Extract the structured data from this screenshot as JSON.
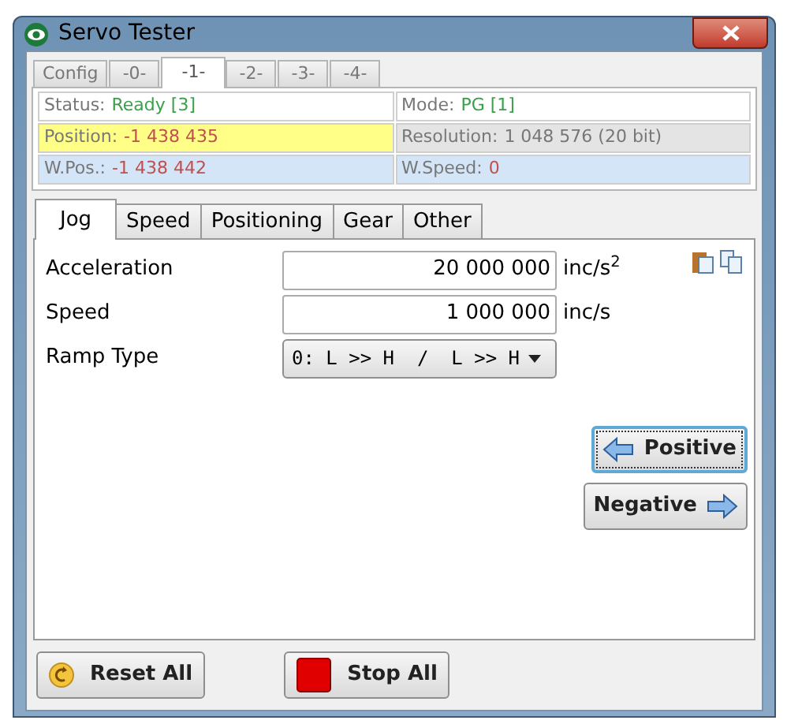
{
  "window": {
    "title": "Servo Tester"
  },
  "tabs": [
    {
      "label": "Config",
      "selected": false
    },
    {
      "label": "-0-",
      "selected": false
    },
    {
      "label": "-1-",
      "selected": true
    },
    {
      "label": "-2-",
      "selected": false
    },
    {
      "label": "-3-",
      "selected": false
    },
    {
      "label": "-4-",
      "selected": false
    }
  ],
  "status_cells": [
    {
      "label": "Status:",
      "value": "Ready [3]",
      "kind": "state",
      "color": "#ffffff"
    },
    {
      "label": "Mode:",
      "value": "PG [1]",
      "kind": "state",
      "color": "#ffffff"
    },
    {
      "label": "Position:",
      "value": "-1 438 435",
      "kind": "measure",
      "color": "#ffff88"
    },
    {
      "label": "Resolution:",
      "value": "1 048 576 (20 bit)",
      "kind": "info",
      "color": "#e4e4e4"
    },
    {
      "label": "W.Pos.:",
      "value": "-1 438 442",
      "kind": "measure",
      "color": "#d3e5f7"
    },
    {
      "label": "W.Speed:",
      "value": "0",
      "kind": "measure",
      "color": "#d3e5f7"
    }
  ],
  "sub_tabs": [
    {
      "label": "Jog",
      "selected": true
    },
    {
      "label": "Speed",
      "selected": false
    },
    {
      "label": "Positioning",
      "selected": false
    },
    {
      "label": "Gear",
      "selected": false
    },
    {
      "label": "Other",
      "selected": false
    }
  ],
  "fields": [
    {
      "kind": "number",
      "label": "Acceleration",
      "value": "20 000 000",
      "unit": "inc/s$^{2}$"
    },
    {
      "kind": "number",
      "label": "Speed",
      "value": "1 000 000",
      "unit": "inc/s"
    },
    {
      "kind": "dropdown",
      "label": "Ramp Type",
      "value": "0: L >> H  /  L >> H"
    }
  ],
  "jog_buttons": [
    {
      "label": "Positive",
      "kind": "left",
      "focused": true
    },
    {
      "label": "Negative",
      "kind": "right",
      "focused": false
    }
  ],
  "bottom_buttons": [
    {
      "label": "Reset All",
      "kind": "reset"
    },
    {
      "label": "Stop All",
      "kind": "stop"
    }
  ]
}
